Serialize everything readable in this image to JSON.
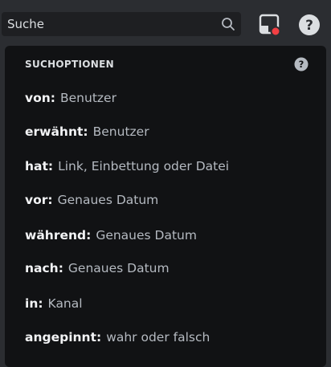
{
  "search": {
    "value": "Suche"
  },
  "icons": {
    "search": "search-icon",
    "inbox": "inbox-icon",
    "help": "help-icon"
  },
  "colors": {
    "background": "#2b2d31",
    "panel": "#111214",
    "key_text": "#f2f3f5",
    "value_text": "#b5bac1",
    "notification_dot": "#f23f43"
  },
  "panel": {
    "title": "SUCHOPTIONEN",
    "options": [
      {
        "key": "von:",
        "value": "Benutzer"
      },
      {
        "key": "erwähnt:",
        "value": "Benutzer"
      },
      {
        "key": "hat:",
        "value": "Link, Einbettung oder Datei"
      },
      {
        "key": "vor:",
        "value": "Genaues Datum"
      },
      {
        "key": "während:",
        "value": "Genaues Datum"
      },
      {
        "key": "nach:",
        "value": "Genaues Datum"
      },
      {
        "key": "in:",
        "value": "Kanal"
      },
      {
        "key": "angepinnt:",
        "value": "wahr oder falsch"
      }
    ]
  }
}
